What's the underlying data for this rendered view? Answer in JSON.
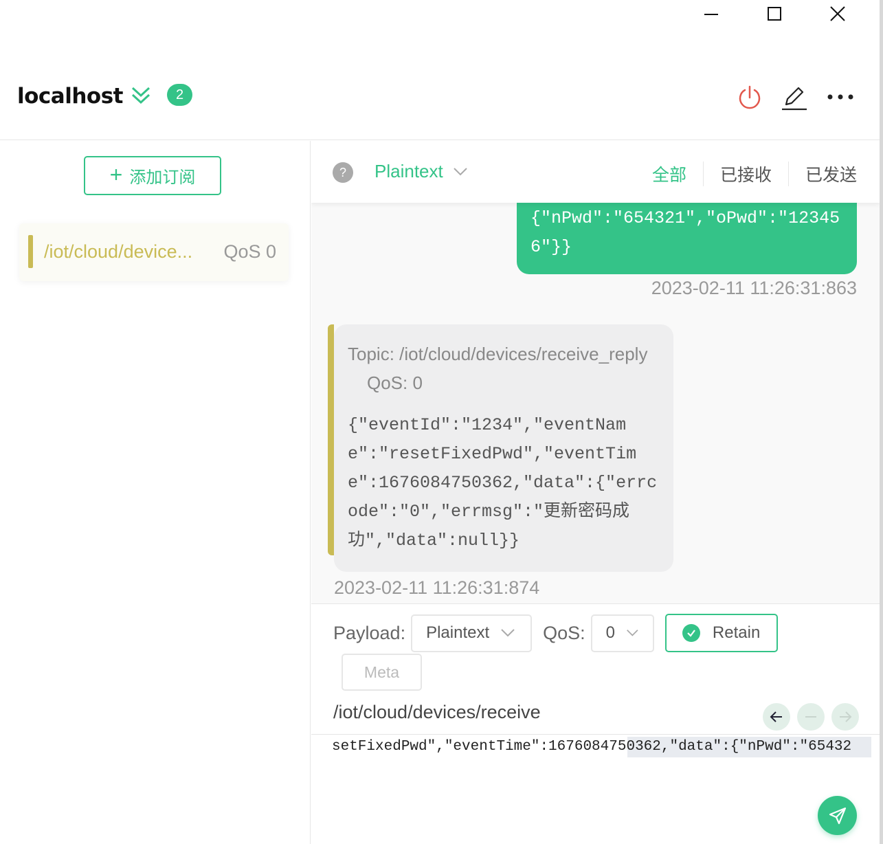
{
  "header": {
    "connection_name": "localhost",
    "badge_count": "2"
  },
  "left": {
    "add_subscription_label": "添加订阅",
    "subscriptions": [
      {
        "topic": "/iot/cloud/device...",
        "qos": "QoS 0",
        "color": "#c9bb55"
      }
    ]
  },
  "messages": {
    "format": "Plaintext",
    "filters": [
      "全部",
      "已接收",
      "已发送"
    ],
    "sent": {
      "payload": "{\"nPwd\":\"654321\",\"oPwd\":\"123456\"}}",
      "time": "2023-02-11 11:26:31:863"
    },
    "received": {
      "topic": "Topic: /iot/cloud/devices/receive_reply",
      "qos": "QoS: 0",
      "payload": "{\"eventId\":\"1234\",\"eventName\":\"resetFixedPwd\",\"eventTime\":1676084750362,\"data\":{\"errcode\":\"0\",\"errmsg\":\"更新密码成功\",\"data\":null}}",
      "time": "2023-02-11 11:26:31:874"
    }
  },
  "publish": {
    "payload_label": "Payload:",
    "payload_format": "Plaintext",
    "qos_label": "QoS:",
    "qos_value": "0",
    "retain_label": "Retain",
    "meta_label": "Meta",
    "topic": "/iot/cloud/devices/receive",
    "payload_text": "setFixedPwd\",\"eventTime\":1676084750362,\"data\":{\"nPwd\":\"65432"
  },
  "colors": {
    "accent": "#34c388",
    "subscription": "#c9bb55",
    "power": "#e2574c"
  }
}
